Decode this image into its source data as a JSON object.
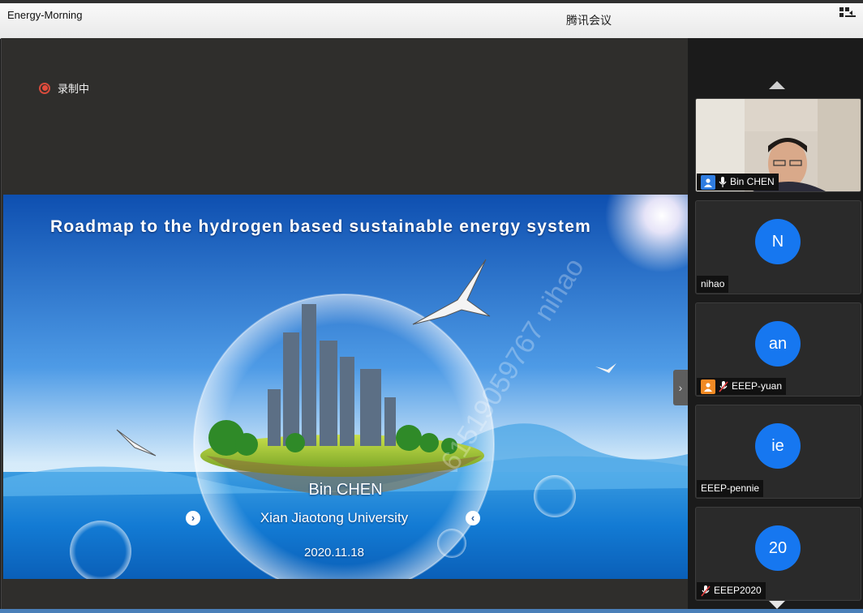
{
  "window": {
    "title": "Energy-Morning",
    "app_name": "腾讯会议"
  },
  "recording": {
    "label": "录制中"
  },
  "slide": {
    "title": "Roadmap to the hydrogen based sustainable energy system",
    "presenter": "Bin CHEN",
    "affiliation": "Xian Jiaotong University",
    "date": "2020.11.18",
    "watermark": "61519059767 nihao"
  },
  "participants": [
    {
      "name": "Bin CHEN",
      "initials": "",
      "video": true
    },
    {
      "name": "nihao",
      "initials": "N",
      "video": false
    },
    {
      "name": "EEEP-yuan",
      "initials": "an",
      "video": false
    },
    {
      "name": "EEEP-pennie",
      "initials": "ie",
      "video": false
    },
    {
      "name": "EEEP2020",
      "initials": "20",
      "video": false
    }
  ],
  "colors": {
    "avatar": "#1677f0",
    "recording": "#e44b3b",
    "host_badge": "#2f7de1",
    "cohost_badge": "#f08a24"
  }
}
